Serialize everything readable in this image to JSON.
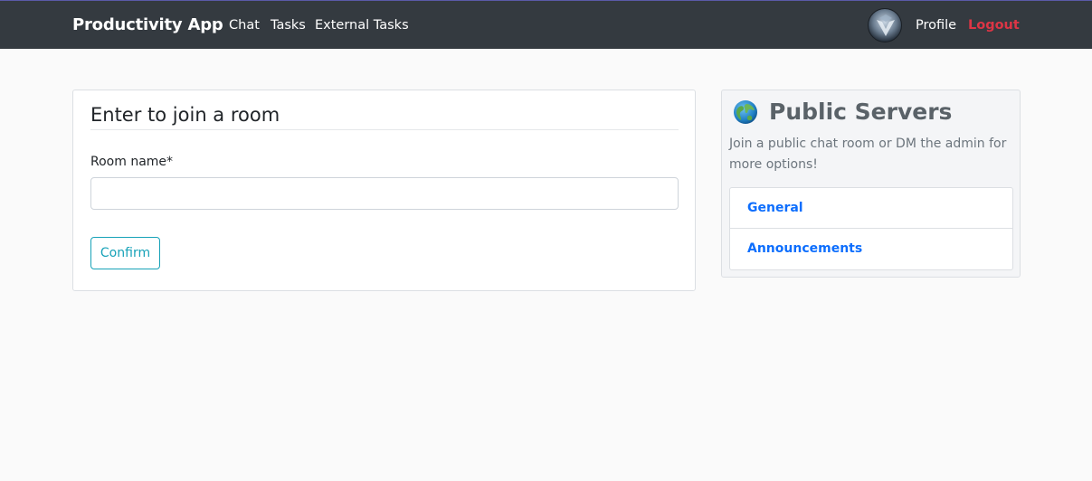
{
  "navbar": {
    "brand": "Productivity App",
    "links": [
      "Chat",
      "Tasks",
      "External Tasks"
    ],
    "profile_label": "Profile",
    "logout_label": "Logout",
    "avatar_icon": "avatar-icon"
  },
  "join_room": {
    "title": "Enter to join a room",
    "field_label": "Room name*",
    "input_value": "",
    "confirm_label": "Confirm"
  },
  "public_servers": {
    "icon": "globe-icon",
    "title": "Public Servers",
    "description": "Join a public chat room or DM the admin for more options!",
    "servers": [
      "General",
      "Announcements"
    ]
  },
  "colors": {
    "navbar_bg": "#343a40",
    "logout": "#dc3545",
    "confirm_outline": "#17a2b8",
    "server_link": "#0d6efd"
  }
}
